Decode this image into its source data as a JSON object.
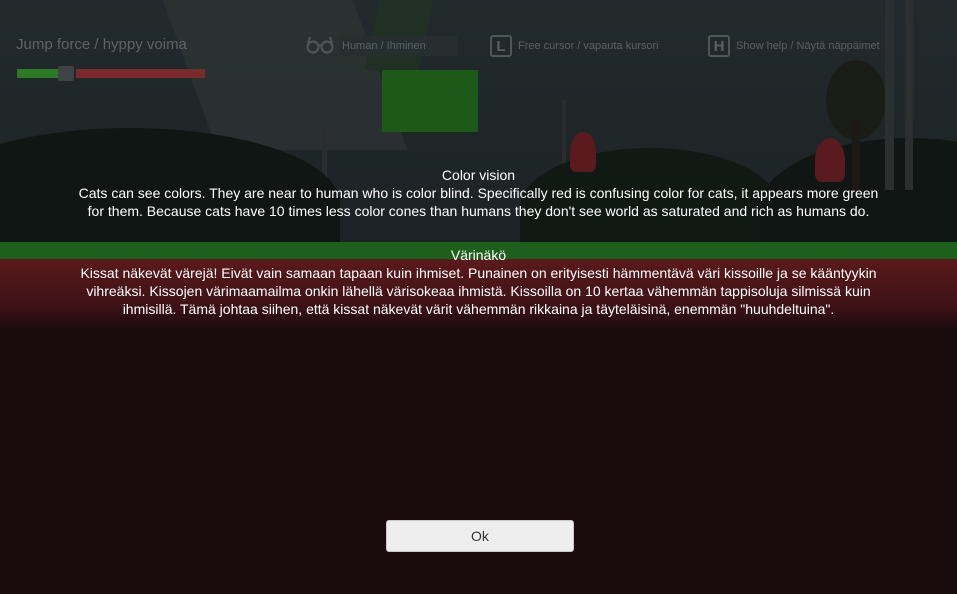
{
  "hud": {
    "jump_force_label": "Jump force / hyppy voima",
    "jump_force_level": 0.25,
    "hints": [
      {
        "icon": "glasses-icon",
        "key": "",
        "label": "Human / Ihminen"
      },
      {
        "icon": "l-key-icon",
        "key": "L",
        "label": "Free cursor / vapauta kursori"
      },
      {
        "icon": "h-key-icon",
        "key": "H",
        "label": "Show help / Näytä näppäimet"
      }
    ]
  },
  "dialog": {
    "en_title": "Color vision",
    "en_body_1": "Cats can see colors. They are near to human who is color blind. Specifically red  is confusing color for cats, it appears more green",
    "en_body_2": "for them. Because cats have 10 times less color cones than humans they don't see world as saturated and rich as humans do.",
    "fi_title": "Värinäkö",
    "fi_body_1": "Kissat näkevät värejä! Eivät vain samaan tapaan kuin ihmiset. Punainen on erityisesti hämmentävä väri kissoille ja se kääntyykin",
    "fi_body_2": "vihreäksi. Kissojen värimaamailma onkin lähellä värisokeaa ihmistä. Kissoilla on 10 kertaa vähemmän tappisoluja silmissä kuin",
    "fi_body_3": "ihmisillä. Tämä johtaa siihen, että kissat näkevät värit vähemmän rikkaina ja täyteläisinä, enemmän \"huuhdeltuina\".",
    "ok_label": "Ok"
  },
  "colors": {
    "ground_green": "#1e5f1b",
    "ground_red": "#5b1a1b",
    "text": "#ffffff",
    "button_bg": "#eeeeee"
  }
}
